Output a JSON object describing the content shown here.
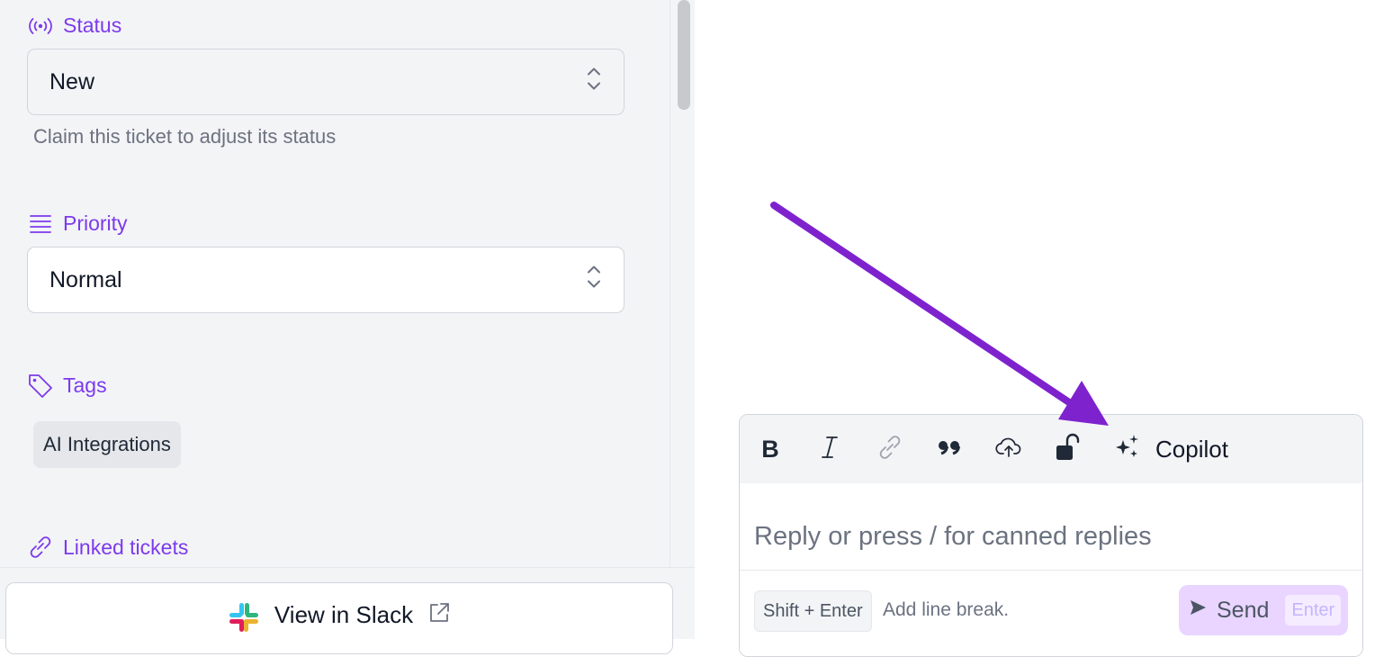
{
  "sidebar": {
    "status": {
      "label": "Status",
      "value": "New",
      "hint": "Claim this ticket to adjust its status"
    },
    "priority": {
      "label": "Priority",
      "value": "Normal"
    },
    "tags": {
      "label": "Tags",
      "items": [
        "AI Integrations"
      ]
    },
    "linked_tickets": {
      "label": "Linked tickets"
    },
    "view_in_slack": {
      "label": "View in Slack"
    }
  },
  "composer": {
    "toolbar": {
      "bold": "B",
      "copilot": "Copilot"
    },
    "reply_placeholder": "Reply or press / for canned replies",
    "shortcut_key": "Shift + Enter",
    "shortcut_hint": "Add line break.",
    "send_label": "Send",
    "send_key": "Enter"
  },
  "colors": {
    "accent": "#7c3aed",
    "annotation_arrow": "#7e22ce",
    "send_bg": "#e9d5ff"
  }
}
